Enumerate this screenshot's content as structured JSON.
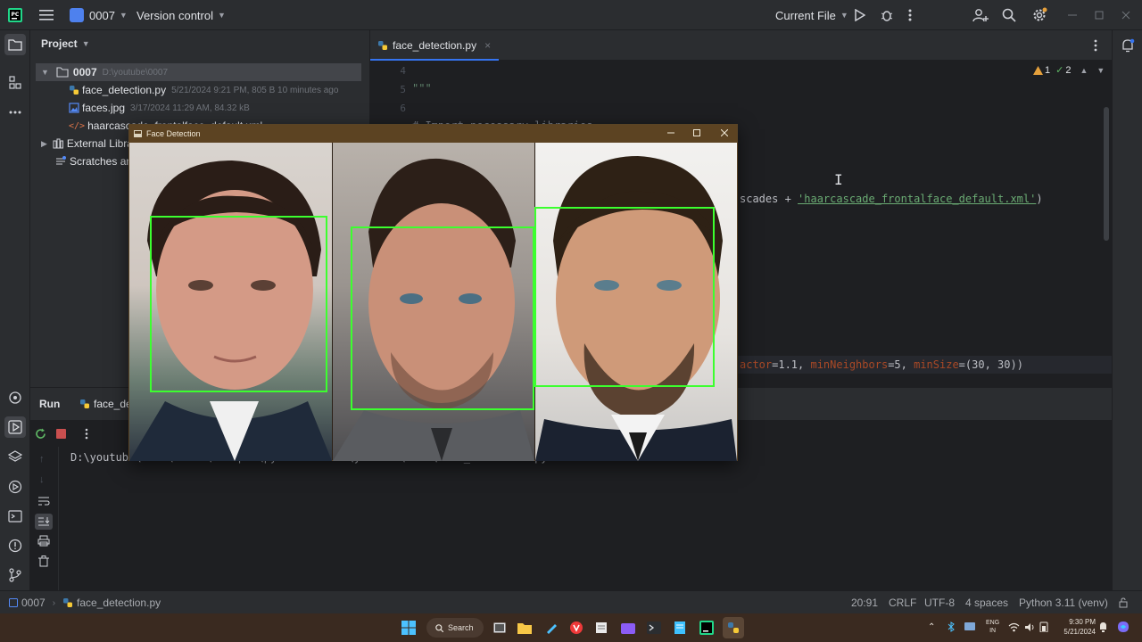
{
  "titlebar": {
    "project": "0007",
    "vcs": "Version control",
    "run_config": "Current File"
  },
  "project_panel": {
    "title": "Project",
    "root": {
      "name": "0007",
      "path": "D:\\youtube\\0007"
    },
    "files": [
      {
        "name": "face_detection.py",
        "meta": "5/21/2024 9:21 PM, 805 B 10 minutes ago"
      },
      {
        "name": "faces.jpg",
        "meta": "3/17/2024 11:29 AM, 84.32 kB"
      },
      {
        "name": "haarcascade_frontalface_default.xml",
        "meta": ""
      }
    ],
    "external": "External Libraries",
    "scratches": "Scratches and Consoles"
  },
  "editor": {
    "tab": "face_detection.py",
    "warnings": "1",
    "checks": "2",
    "lines": [
      {
        "num": "4",
        "text": ""
      },
      {
        "num": "5",
        "text": "\"\"\""
      },
      {
        "num": "6",
        "text": ""
      }
    ],
    "line7_partial": "# Import necessary libraries",
    "cascade_left": "scades + ",
    "cascade_string": "'haarcascade_frontalface_default.xml'",
    "cascade_right": ")",
    "detect_left": "actor",
    "detect_rest": "=1.1, ",
    "detect_mn": "minNeighbors",
    "detect_mn_val": "=5, ",
    "detect_ms": "minSize",
    "detect_ms_val": "=(30, 30))"
  },
  "run_panel": {
    "label": "Run",
    "tab": "face_detection",
    "console": "D:\\youtube\\0007\\.venv\\Scripts\\python.exe D:\\youtube\\0007\\face_detection.py"
  },
  "popup": {
    "title": "Face Detection"
  },
  "statusbar": {
    "crumb_project": "0007",
    "crumb_file": "face_detection.py",
    "position": "20:91",
    "line_sep": "CRLF",
    "encoding": "UTF-8",
    "indent": "4 spaces",
    "interpreter": "Python 3.11 (venv)"
  },
  "taskbar": {
    "search": "Search",
    "lang_top": "ENG",
    "lang_bottom": "IN",
    "time": "9:30 PM",
    "date": "5/21/2024"
  },
  "colors": {
    "accent": "#3574f0",
    "face_box": "#3cff2f"
  }
}
